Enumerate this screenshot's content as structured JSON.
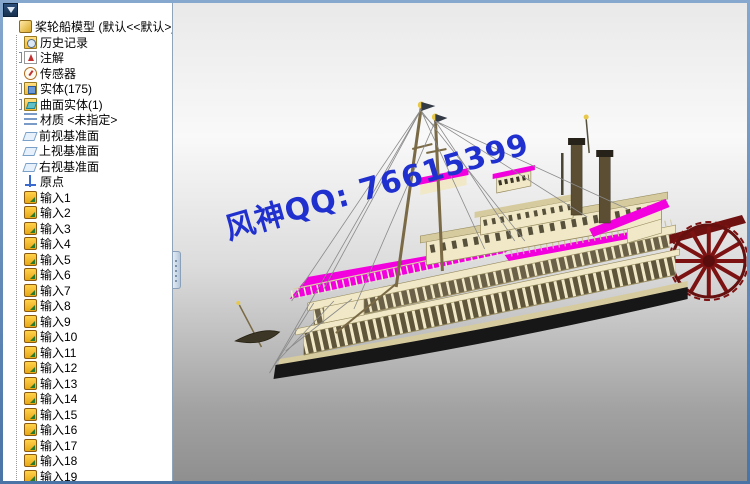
{
  "window": {
    "frame_color": "#4f7ab0"
  },
  "feature_tree": {
    "root_label": "桨轮船模型 (默认<<默认>_显",
    "items": [
      {
        "label": "历史记录",
        "icon": "history-icon",
        "base": "folderish",
        "expander": "none"
      },
      {
        "label": "注解",
        "icon": "annotations-icon",
        "base": "",
        "expander": "plus"
      },
      {
        "label": "传感器",
        "icon": "sensors-icon",
        "base": "",
        "expander": "none"
      },
      {
        "label": "实体(175)",
        "icon": "solid-folder-icon",
        "base": "folderish",
        "expander": "plus"
      },
      {
        "label": "曲面实体(1)",
        "icon": "surface-folder-icon",
        "base": "folderish",
        "expander": "plus"
      },
      {
        "label": "材质 <未指定>",
        "icon": "material-icon",
        "base": "",
        "expander": "none"
      },
      {
        "label": "前视基准面",
        "icon": "plane-icon",
        "base": "",
        "expander": "none"
      },
      {
        "label": "上视基准面",
        "icon": "plane-icon",
        "base": "",
        "expander": "none"
      },
      {
        "label": "右视基准面",
        "icon": "plane-icon",
        "base": "",
        "expander": "none"
      },
      {
        "label": "原点",
        "icon": "origin-icon",
        "base": "",
        "expander": "none"
      },
      {
        "label": "输入1",
        "icon": "imported-icon",
        "base": "",
        "expander": "none"
      },
      {
        "label": "输入2",
        "icon": "imported-icon",
        "base": "",
        "expander": "none"
      },
      {
        "label": "输入3",
        "icon": "imported-icon",
        "base": "",
        "expander": "none"
      },
      {
        "label": "输入4",
        "icon": "imported-icon",
        "base": "",
        "expander": "none"
      },
      {
        "label": "输入5",
        "icon": "imported-icon",
        "base": "",
        "expander": "none"
      },
      {
        "label": "输入6",
        "icon": "imported-icon",
        "base": "",
        "expander": "none"
      },
      {
        "label": "输入7",
        "icon": "imported-icon",
        "base": "",
        "expander": "none"
      },
      {
        "label": "输入8",
        "icon": "imported-icon",
        "base": "",
        "expander": "none"
      },
      {
        "label": "输入9",
        "icon": "imported-icon",
        "base": "",
        "expander": "none"
      },
      {
        "label": "输入10",
        "icon": "imported-icon",
        "base": "",
        "expander": "none"
      },
      {
        "label": "输入11",
        "icon": "imported-icon",
        "base": "",
        "expander": "none"
      },
      {
        "label": "输入12",
        "icon": "imported-icon",
        "base": "",
        "expander": "none"
      },
      {
        "label": "输入13",
        "icon": "imported-icon",
        "base": "",
        "expander": "none"
      },
      {
        "label": "输入14",
        "icon": "imported-icon",
        "base": "",
        "expander": "none"
      },
      {
        "label": "输入15",
        "icon": "imported-icon",
        "base": "",
        "expander": "none"
      },
      {
        "label": "输入16",
        "icon": "imported-icon",
        "base": "",
        "expander": "none"
      },
      {
        "label": "输入17",
        "icon": "imported-icon",
        "base": "",
        "expander": "none"
      },
      {
        "label": "输入18",
        "icon": "imported-icon",
        "base": "",
        "expander": "none"
      },
      {
        "label": "输入19",
        "icon": "imported-icon",
        "base": "",
        "expander": "none"
      }
    ]
  },
  "viewport": {
    "watermark": "风神QQ: 76615399"
  },
  "colors": {
    "magenta": "#f200dd",
    "cream": "#f0e8c6",
    "cream_dark": "#d6cb9e",
    "deck_dark": "#5e553a",
    "hull": "#171717",
    "wheel": "#7c1212",
    "mast": "#7a6a45",
    "watermark": "#2030cf"
  }
}
